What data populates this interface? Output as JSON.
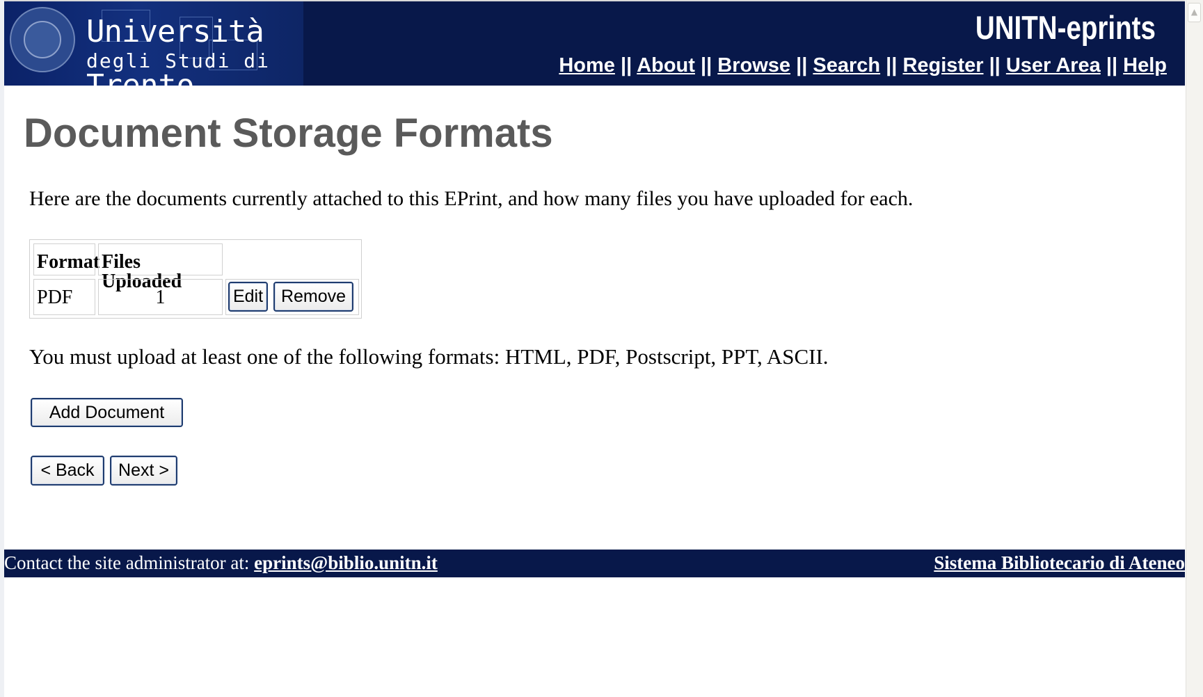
{
  "header": {
    "university_line1": "Università",
    "university_line2_prefix": "degli Studi di ",
    "university_line2_city": "Trento",
    "site_title": "UNITN-eprints",
    "nav": {
      "home": "Home",
      "about": "About",
      "browse": "Browse",
      "search": "Search",
      "register": "Register",
      "user_area": "User Area",
      "help": "Help",
      "separator": " || "
    }
  },
  "main": {
    "title": "Document Storage Formats",
    "intro": "Here are the documents currently attached to this EPrint, and how many files you have uploaded for each.",
    "table": {
      "headers": [
        "Format",
        "Files Uploaded"
      ],
      "rows": [
        {
          "format": "PDF",
          "files_uploaded": "1",
          "edit_label": "Edit",
          "remove_label": "Remove"
        }
      ]
    },
    "requirement": "You must upload at least one of the following formats: HTML, PDF, Postscript, PPT, ASCII.",
    "add_document_label": "Add Document",
    "back_label": "< Back",
    "next_label": "Next >"
  },
  "footer": {
    "contact_prefix": "Contact the site administrator at: ",
    "contact_email": "eprints@biblio.unitn.it",
    "library_link": "Sistema Bibliotecario di Ateneo"
  },
  "colors": {
    "header_bg": "#08184a",
    "title_gray": "#5a5a5a",
    "button_border": "#1e3b6e"
  },
  "icons": {
    "seal": "university-seal-icon",
    "scroll_up": "scroll-up-arrow-icon"
  }
}
